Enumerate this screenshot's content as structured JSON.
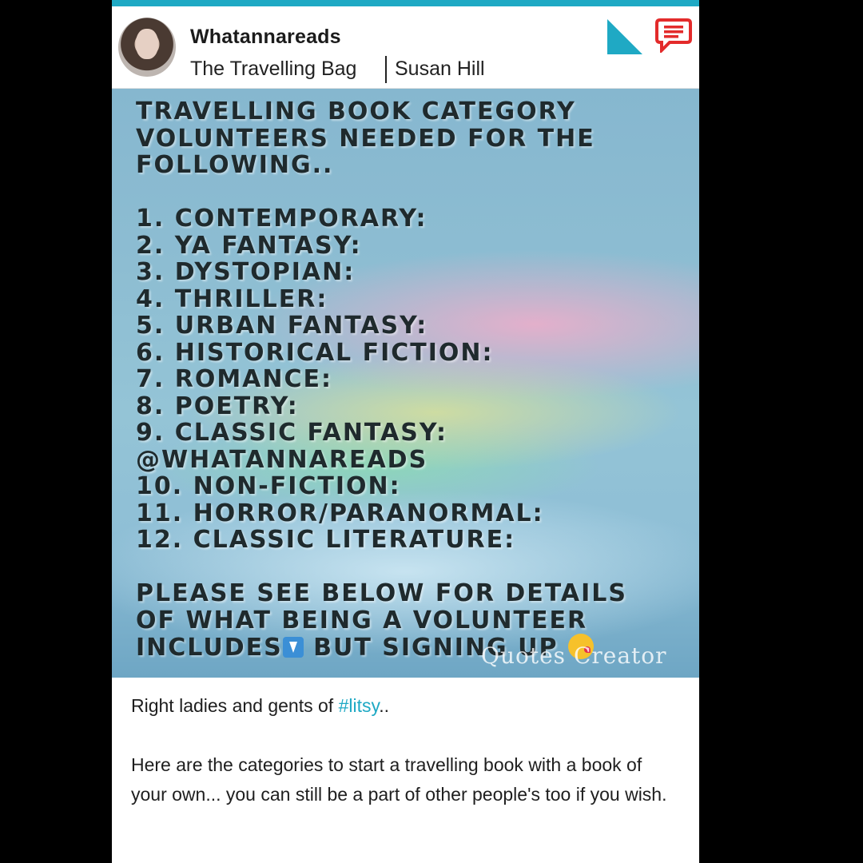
{
  "header": {
    "username": "Whatannareads",
    "book_title": "The Travelling Bag",
    "book_author": "Susan Hill",
    "accent_color": "#1fa9c4",
    "comment_icon_color": "#e32b2b"
  },
  "post_image": {
    "lines": [
      "TRAVELLING BOOK CATEGORY",
      "VOLUNTEERS NEEDED FOR THE",
      "FOLLOWING..",
      "",
      "1. CONTEMPORARY:",
      "2. YA FANTASY:",
      "3. DYSTOPIAN:",
      "4. THRILLER:",
      "5. URBAN FANTASY:",
      "6. HISTORICAL FICTION:",
      "7. ROMANCE:",
      "8. POETRY:",
      "9. CLASSIC FANTASY:",
      "@WHATANNAREADS",
      "10. NON-FICTION:",
      "11. HORROR/PARANORMAL:",
      "12. CLASSIC LITERATURE:",
      "",
      "PLEASE SEE BELOW FOR DETAILS",
      "OF WHAT BEING A VOLUNTEER"
    ],
    "last_line_a": "INCLUDES",
    "last_line_b": " BUT SIGNING UP ",
    "watermark": "Quotes Creator"
  },
  "caption": {
    "line1_prefix": "Right ladies and gents of ",
    "hashtag": "#litsy",
    "line1_suffix": "..",
    "paragraph2": "Here are the categories to start a travelling book with a book of your own... you can still be a part of other people's too if you wish."
  }
}
